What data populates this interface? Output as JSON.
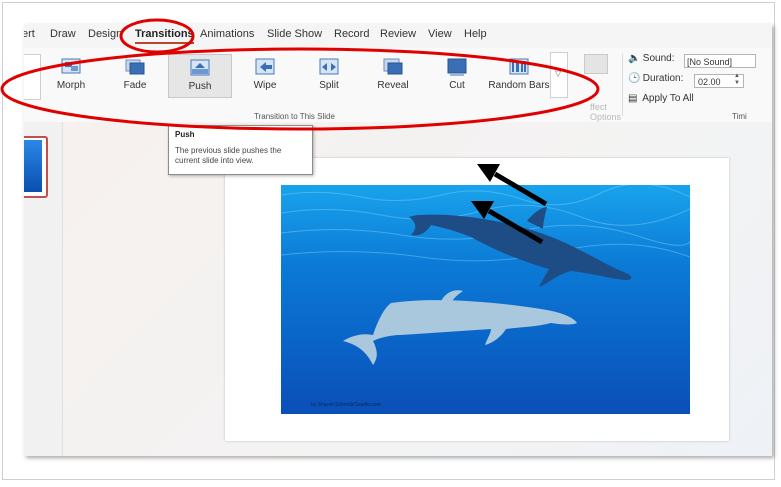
{
  "tabs": [
    "ert",
    "Draw",
    "Design",
    "Transitions",
    "Animations",
    "Slide Show",
    "Record",
    "Review",
    "View",
    "Help"
  ],
  "active_tab": "Transitions",
  "transitions": [
    "Morph",
    "Fade",
    "Push",
    "Wipe",
    "Split",
    "Reveal",
    "Cut",
    "Random Bars"
  ],
  "selected_transition": "Push",
  "effect_options": {
    "label_line1": "ffect",
    "label_line2": "Options"
  },
  "group_label": "Transition to This Slide",
  "timing": {
    "sound_label": "Sound:",
    "sound_value": "[No Sound]",
    "duration_label": "Duration:",
    "duration_value": "02.00",
    "apply_all_label": "Apply To All",
    "group_label": "Timi"
  },
  "tooltip": {
    "title": "Push",
    "body": "The previous slide pushes the current slide into view."
  },
  "photo_caption": "by Sharon Schmidt/Sealife.com",
  "colors": {
    "annotation_red": "#e00000",
    "annotation_arrow": "#000000",
    "accent": "#b7472a"
  }
}
